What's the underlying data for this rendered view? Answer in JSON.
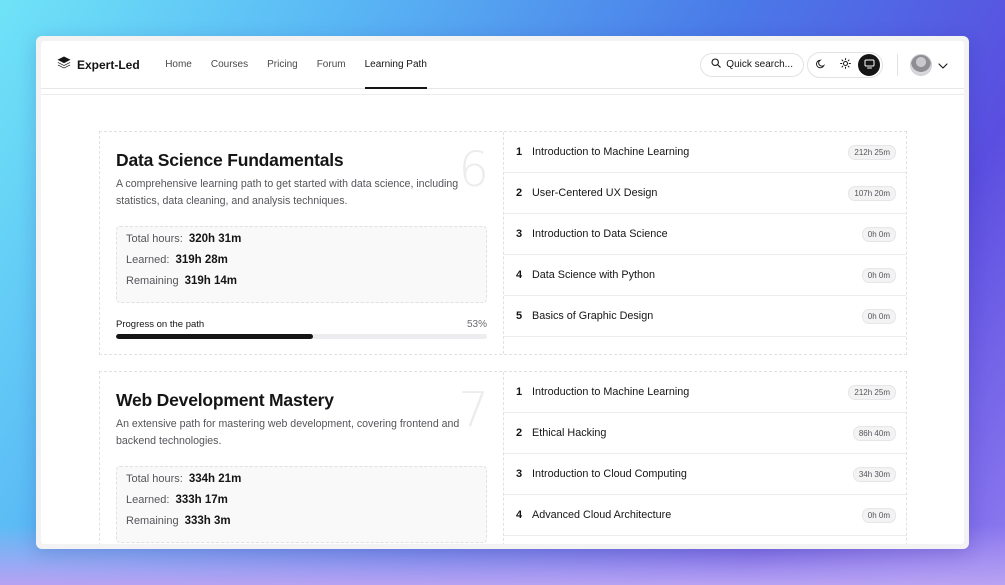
{
  "nav": {
    "brand": "Expert-Led",
    "links": [
      "Home",
      "Courses",
      "Pricing",
      "Forum",
      "Learning Path"
    ],
    "active_link": "Learning Path",
    "search_label": "Quick search..."
  },
  "paths": [
    {
      "number": "6",
      "title": "Data Science Fundamentals",
      "description": "A comprehensive learning path to get started with data science, including statistics, data cleaning, and analysis techniques.",
      "total_label": "Total hours:",
      "total_value": "320h 31m",
      "learned_label": "Learned:",
      "learned_value": "319h 28m",
      "remaining_label": "Remaining",
      "remaining_value": "319h 14m",
      "progress_label": "Progress on the path",
      "progress_pct": "53%",
      "progress_value": 53,
      "courses": [
        {
          "index": "1",
          "title": "Introduction to Machine Learning",
          "time": "212h 25m"
        },
        {
          "index": "2",
          "title": "User-Centered UX Design",
          "time": "107h 20m"
        },
        {
          "index": "3",
          "title": "Introduction to Data Science",
          "time": "0h 0m"
        },
        {
          "index": "4",
          "title": "Data Science with Python",
          "time": "0h 0m"
        },
        {
          "index": "5",
          "title": "Basics of Graphic Design",
          "time": "0h 0m"
        }
      ]
    },
    {
      "number": "7",
      "title": "Web Development Mastery",
      "description": "An extensive path for mastering web development, covering frontend and backend technologies.",
      "total_label": "Total hours:",
      "total_value": "334h 21m",
      "learned_label": "Learned:",
      "learned_value": "333h 17m",
      "remaining_label": "Remaining",
      "remaining_value": "333h 3m",
      "courses": [
        {
          "index": "1",
          "title": "Introduction to Machine Learning",
          "time": "212h 25m"
        },
        {
          "index": "2",
          "title": "Ethical Hacking",
          "time": "86h 40m"
        },
        {
          "index": "3",
          "title": "Introduction to Cloud Computing",
          "time": "34h 30m"
        },
        {
          "index": "4",
          "title": "Advanced Cloud Architecture",
          "time": "0h 0m"
        }
      ]
    }
  ],
  "icons": {
    "brand": "layers-icon",
    "search": "search-icon",
    "theme": [
      "moon-icon",
      "sun-icon",
      "monitor-icon"
    ],
    "account": "chevron-down-icon"
  }
}
